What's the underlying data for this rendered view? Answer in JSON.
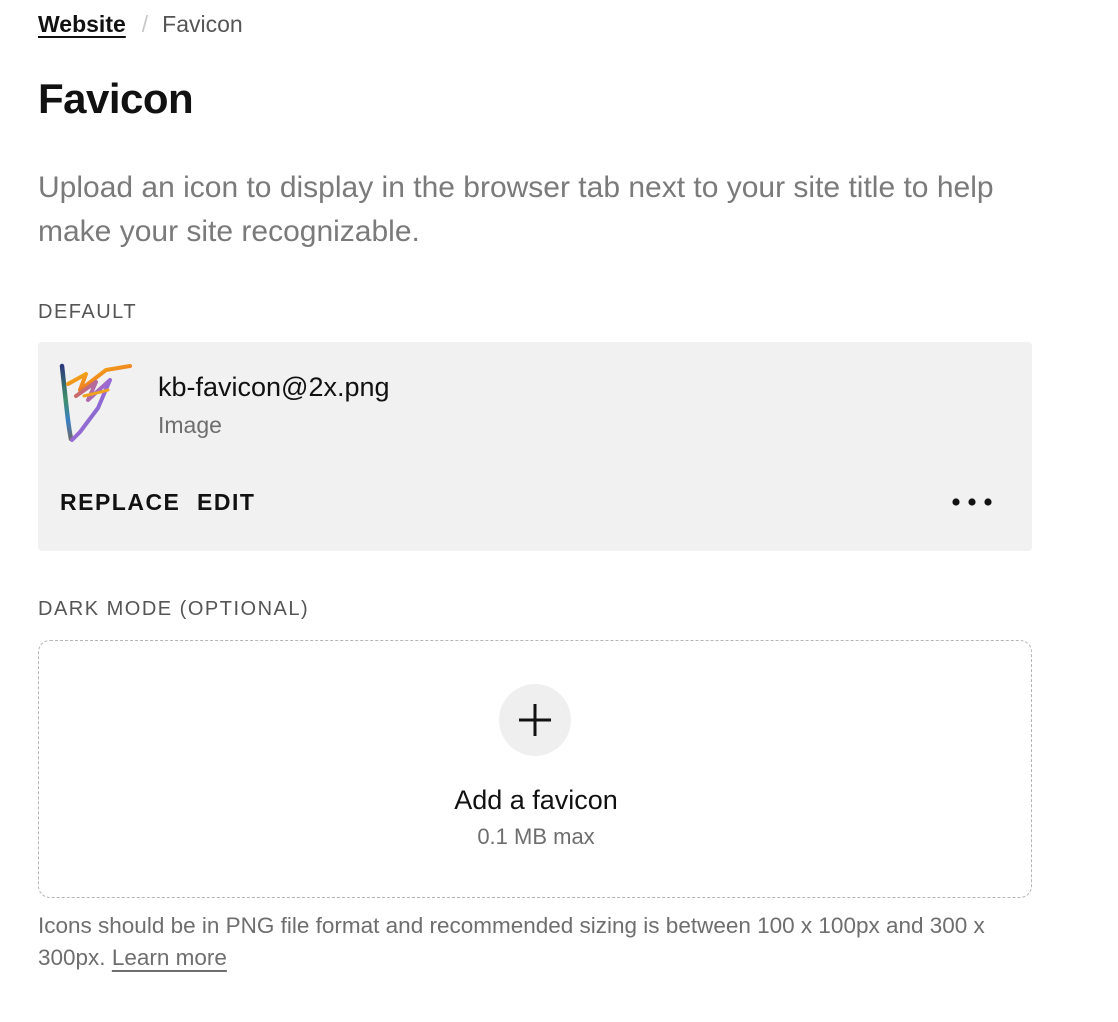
{
  "breadcrumb": {
    "parent": "Website",
    "separator": "/",
    "current": "Favicon"
  },
  "page": {
    "title": "Favicon",
    "description": "Upload an icon to display in the browser tab next to your site title to help make your site recognizable."
  },
  "default_section": {
    "label": "DEFAULT",
    "file": {
      "name": "kb-favicon@2x.png",
      "type": "Image",
      "thumbnail_icon": "favicon-thumbnail-icon"
    },
    "actions": {
      "replace_label": "REPLACE",
      "edit_label": "EDIT",
      "more_icon": "more-horizontal-icon"
    }
  },
  "dark_mode_section": {
    "label": "DARK MODE (OPTIONAL)",
    "dropzone": {
      "icon": "plus-icon",
      "title": "Add a favicon",
      "size_limit": "0.1 MB max"
    }
  },
  "help": {
    "text": "Icons should be in PNG file format and recommended sizing is between 100 x 100px and 300 x 300px. ",
    "link_label": "Learn more"
  },
  "colors": {
    "card_background": "#f1f1f1",
    "dropzone_border": "#b5b5b5",
    "muted_text": "#6e6e6e"
  }
}
